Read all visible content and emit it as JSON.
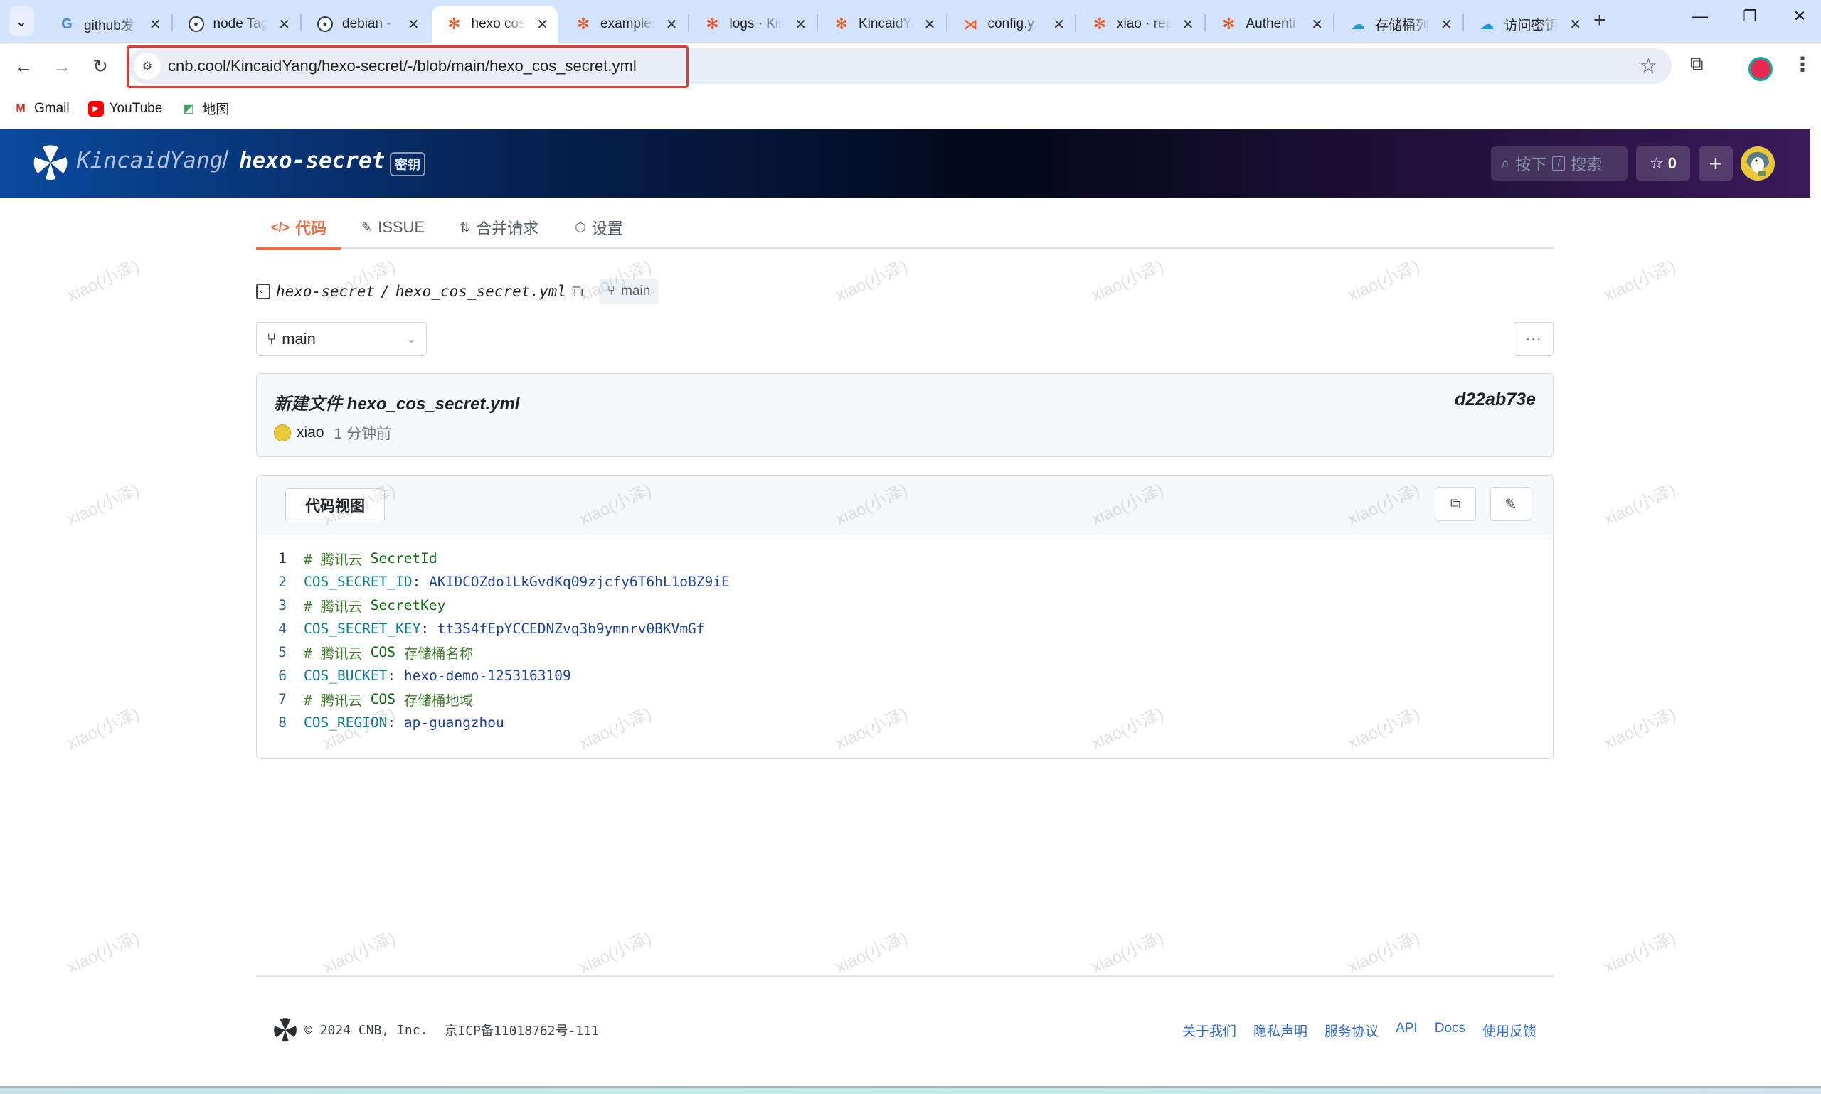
{
  "browser": {
    "tabs": [
      {
        "title": "github发",
        "favicon": "google-icon",
        "active": false
      },
      {
        "title": "node Tag",
        "favicon": "docker-icon",
        "active": false
      },
      {
        "title": "debian -",
        "favicon": "docker-icon",
        "active": false
      },
      {
        "title": "hexo cos",
        "favicon": "cnb-icon",
        "active": true
      },
      {
        "title": "examples",
        "favicon": "cnb-icon",
        "active": false
      },
      {
        "title": "logs · Kin",
        "favicon": "cnb-icon",
        "active": false
      },
      {
        "title": "KincaidYa",
        "favicon": "cnb-icon",
        "active": false
      },
      {
        "title": "config.y",
        "favicon": "vscode-icon",
        "active": false
      },
      {
        "title": "xiao · rep",
        "favicon": "cnb-icon",
        "active": false
      },
      {
        "title": "Authenti",
        "favicon": "cnb-icon",
        "active": false
      },
      {
        "title": "存储桶列",
        "favicon": "tencent-cloud-icon",
        "active": false
      },
      {
        "title": "访问密钥",
        "favicon": "tencent-cloud-icon",
        "active": false
      }
    ],
    "url": "cnb.cool/KincaidYang/hexo-secret/-/blob/main/hexo_cos_secret.yml",
    "bookmarks": [
      {
        "label": "Gmail",
        "icon": "gmail-icon"
      },
      {
        "label": "YouTube",
        "icon": "youtube-icon"
      },
      {
        "label": "地图",
        "icon": "maps-icon"
      }
    ]
  },
  "header": {
    "owner": "KincaidYang",
    "separator": "/",
    "repo": "hexo-secret",
    "badge": "密钥",
    "search_label_pre": "按下",
    "search_key": "/",
    "search_label_post": "搜索",
    "star_count": "0",
    "plus": "+"
  },
  "repo_nav": {
    "tabs": [
      {
        "label": "代码",
        "icon": "code-icon",
        "active": true
      },
      {
        "label": "ISSUE",
        "icon": "issue-icon",
        "active": false
      },
      {
        "label": "合并请求",
        "icon": "pull-request-icon",
        "active": false
      },
      {
        "label": "设置",
        "icon": "settings-icon",
        "active": false
      }
    ]
  },
  "breadcrumb": {
    "repo": "hexo-secret",
    "sep": "/",
    "file": "hexo_cos_secret.yml",
    "branch": "main"
  },
  "branch_select": {
    "value": "main"
  },
  "more_button": "···",
  "commit": {
    "message": "新建文件 hexo_cos_secret.yml",
    "sha": "d22ab73e",
    "author": "xiao",
    "time": "1 分钟前"
  },
  "code_panel": {
    "view_label": "代码视图",
    "lines": [
      {
        "n": "1",
        "type": "comment",
        "prefix": "# 腾讯云 ",
        "word": "SecretId",
        "suffix": ""
      },
      {
        "n": "2",
        "type": "kv",
        "key": "COS_SECRET_ID",
        "value": "AKIDCOZdo1LkGvdKq09zjcfy6T6hL1oBZ9iE"
      },
      {
        "n": "3",
        "type": "comment",
        "prefix": "# 腾讯云 ",
        "word": "SecretKey",
        "suffix": ""
      },
      {
        "n": "4",
        "type": "kv",
        "key": "COS_SECRET_KEY",
        "value": "tt3S4fEpYCCEDNZvq3b9ymnrv0BKVmGf"
      },
      {
        "n": "5",
        "type": "comment",
        "prefix": "# 腾讯云 ",
        "word": "COS",
        "suffix": " 存储桶名称"
      },
      {
        "n": "6",
        "type": "kv",
        "key": "COS_BUCKET",
        "value": "hexo-demo-1253163109"
      },
      {
        "n": "7",
        "type": "comment",
        "prefix": "# 腾讯云 ",
        "word": "COS",
        "suffix": " 存储桶地域"
      },
      {
        "n": "8",
        "type": "kv",
        "key": "COS_REGION",
        "value": "ap-guangzhou"
      }
    ]
  },
  "watermark": "xiao(小泽)",
  "footer": {
    "copyright": "© 2024 CNB, Inc.",
    "icp": "京ICP备11018762号-111",
    "links": [
      "关于我们",
      "隐私声明",
      "服务协议",
      "API",
      "Docs",
      "使用反馈"
    ]
  },
  "colors": {
    "accent": "#ef6b3f",
    "link": "#2f6bd2",
    "highlight_box": "#e53935"
  }
}
